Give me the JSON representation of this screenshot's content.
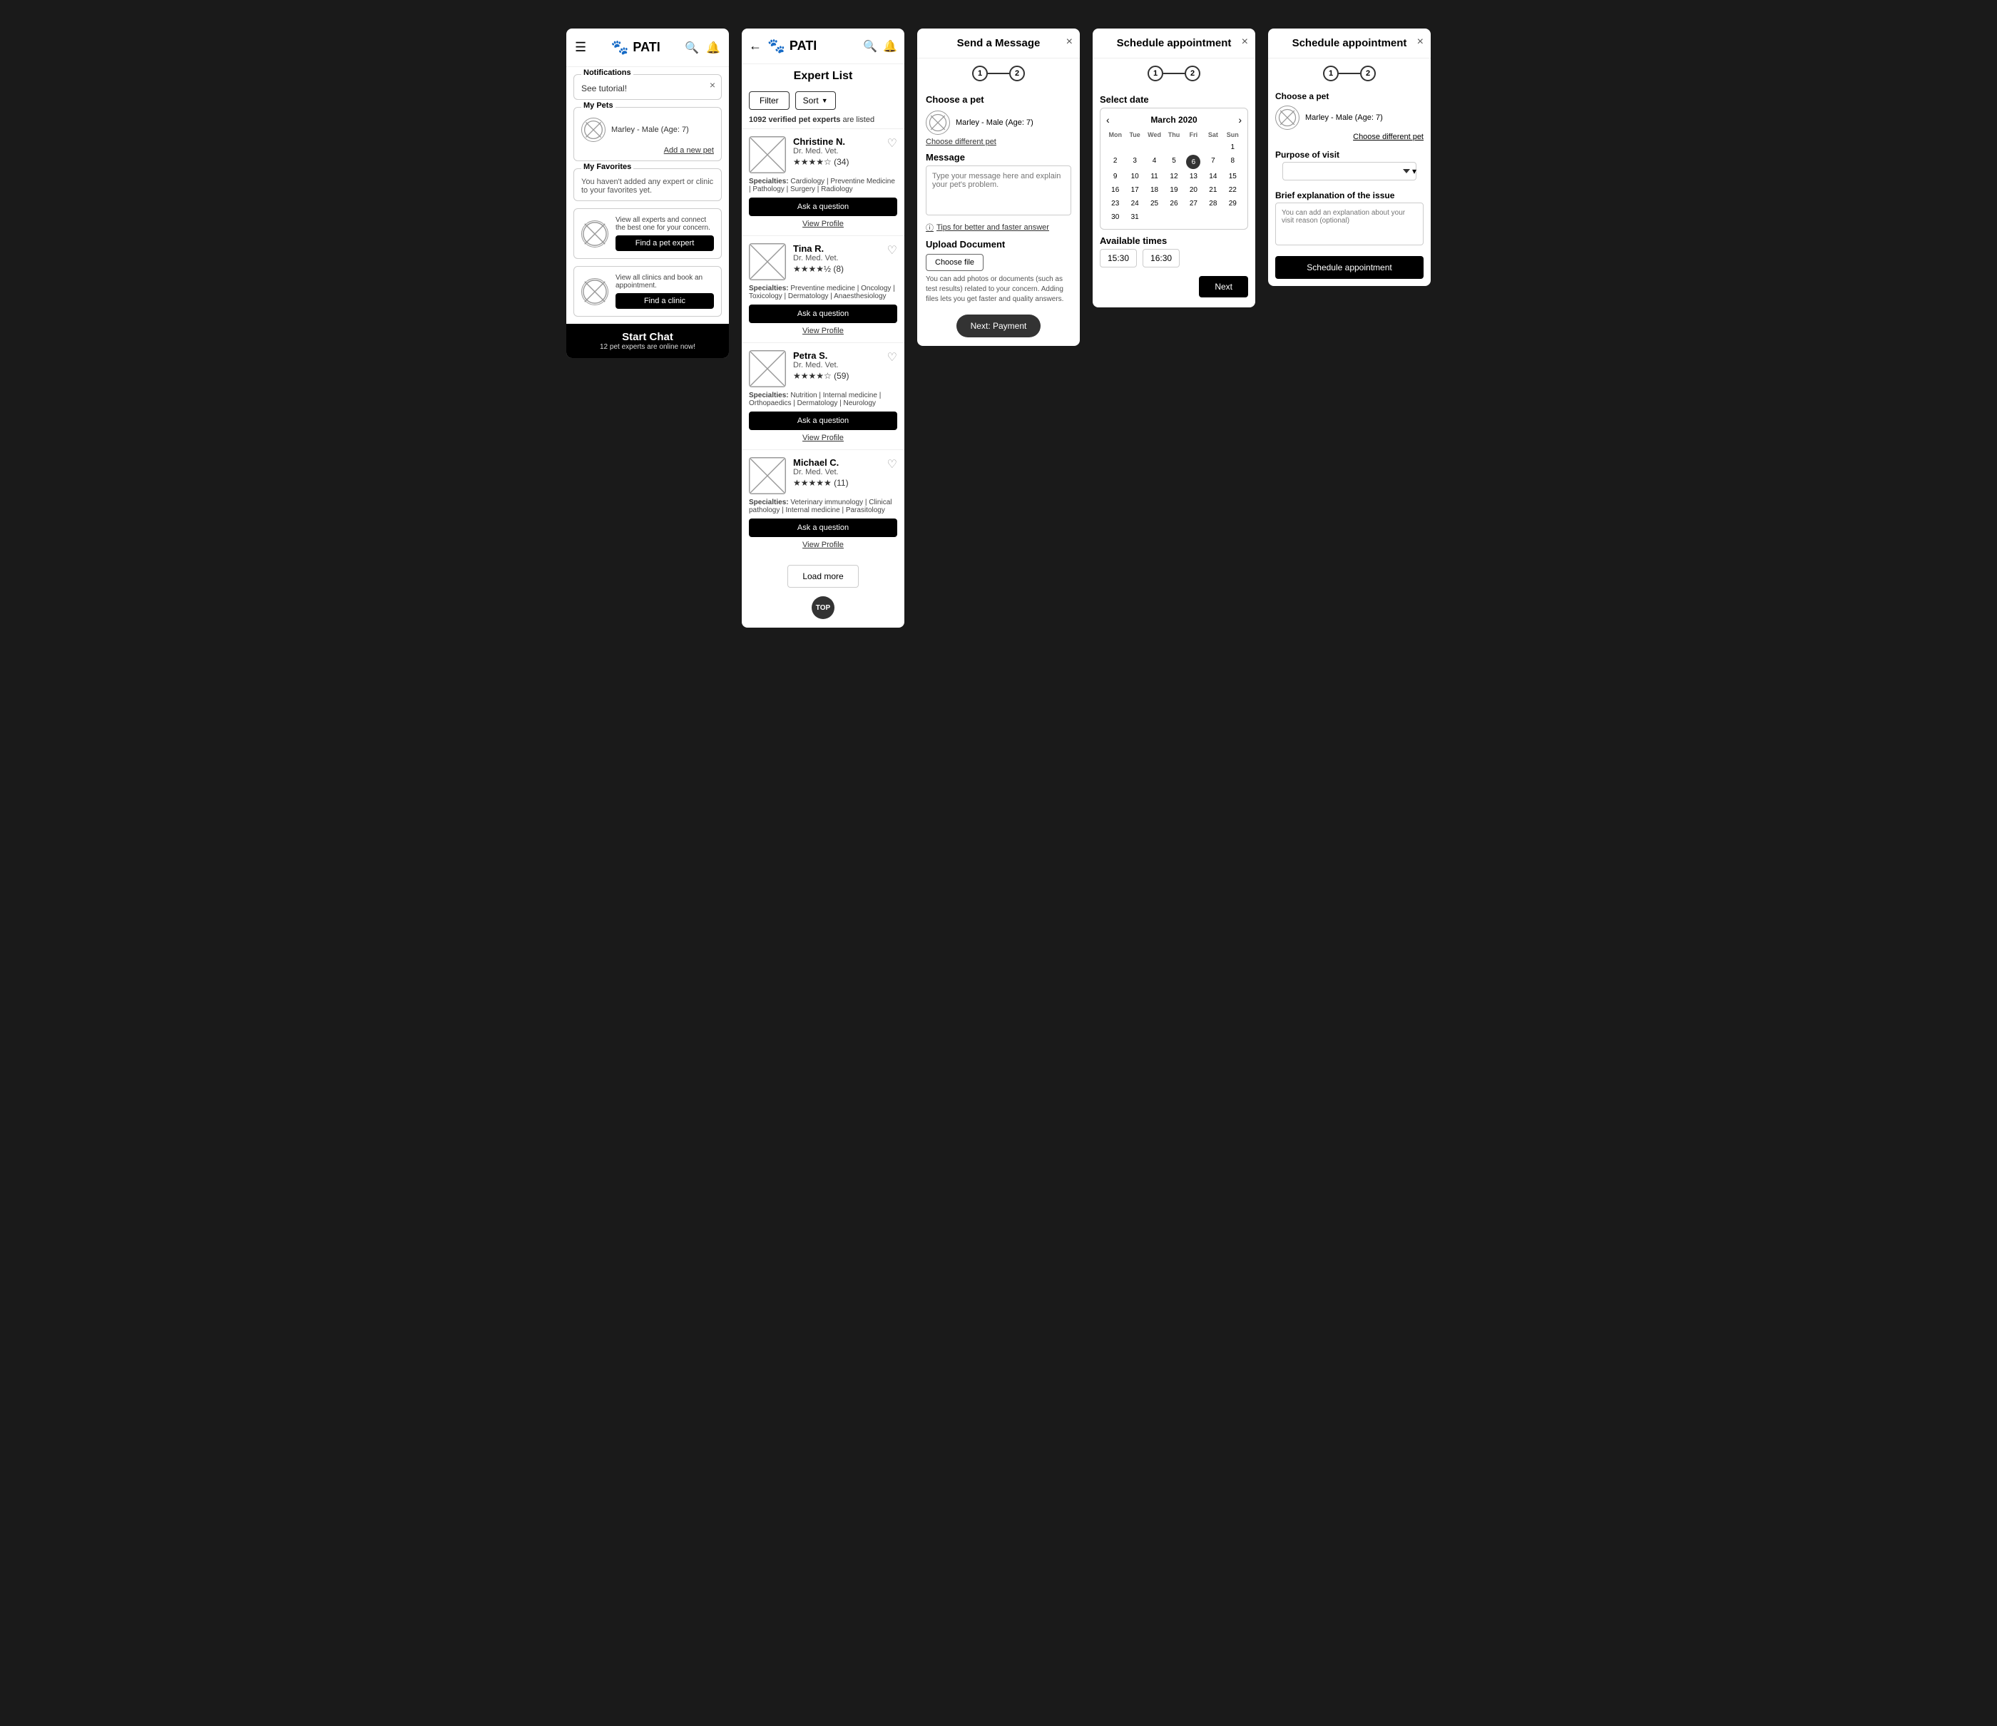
{
  "screen1": {
    "logo": "PATI",
    "notifications": {
      "label": "Notifications",
      "text": "See tutorial!"
    },
    "my_pets": {
      "label": "My Pets",
      "pet": "Marley - Male (Age: 7)",
      "add_pet": "Add a new pet"
    },
    "my_favorites": {
      "label": "My Favorites",
      "text": "You haven't added any expert or clinic to your favorites yet."
    },
    "find_expert": {
      "description": "View all experts and connect the best one for your concern.",
      "button": "Find a pet expert"
    },
    "find_clinic": {
      "description": "View all clinics and  book an appointment.",
      "button": "Find a clinic"
    },
    "start_chat": {
      "title": "Start Chat",
      "subtitle": "12 pet experts are online now!"
    }
  },
  "screen2": {
    "logo": "PATI",
    "title": "Expert List",
    "filter_btn": "Filter",
    "sort_btn": "Sort",
    "expert_count": "1092 verified pet experts are listed",
    "experts": [
      {
        "name": "Christine N.",
        "degree": "Dr. Med. Vet.",
        "rating": "3.5",
        "rating_count": "(34)",
        "specialties": "Cardiology | Preventine Medicine | Pathology | Surgery | Radiology",
        "ask_btn": "Ask a question",
        "view_profile": "View Profile"
      },
      {
        "name": "Tina R.",
        "degree": "Dr. Med. Vet.",
        "rating": "4.5",
        "rating_count": "(8)",
        "specialties": "Preventine medicine | Oncology | Toxicology | Dermatology | Anaesthesiology",
        "ask_btn": "Ask a question",
        "view_profile": "View Profile"
      },
      {
        "name": "Petra S.",
        "degree": "Dr. Med. Vet.",
        "rating": "4.0",
        "rating_count": "(59)",
        "specialties": "Nutrition | Internal medicine | Orthopaedics | Dermatology | Neurology",
        "ask_btn": "Ask a question",
        "view_profile": "View Profile"
      },
      {
        "name": "Michael C.",
        "degree": "Dr. Med. Vet.",
        "rating": "5.0",
        "rating_count": "(11)",
        "specialties": "Veterinary immunology | Clinical pathology | Internal medicine | Parasitology",
        "ask_btn": "Ask a question",
        "view_profile": "View Profile"
      }
    ],
    "load_more": "Load more",
    "top": "TOP"
  },
  "screen3": {
    "title": "Send a Message",
    "close": "×",
    "step1": "1",
    "step2": "2",
    "choose_pet_label": "Choose a pet",
    "pet_name": "Marley - Male (Age: 7)",
    "choose_different": "Choose different pet",
    "message_label": "Message",
    "message_placeholder": "Type your message here and explain your pet's problem.",
    "tips_link": "Tips for better and faster answer",
    "upload_title": "Upload Document",
    "choose_file_btn": "Choose file",
    "upload_desc": "You can add photos or documents (such as test results) related to your concern. Adding files lets you get faster and quality answers.",
    "next_btn": "Next: Payment"
  },
  "screen4": {
    "title": "Schedule appointment",
    "close": "×",
    "step1": "1",
    "step2": "2",
    "select_date_label": "Select date",
    "month": "March 2020",
    "days_header": [
      "Mon",
      "Tue",
      "Wed",
      "Thu",
      "Fri",
      "Sat",
      "Sun"
    ],
    "days": [
      {
        "day": "",
        "empty": true
      },
      {
        "day": "",
        "empty": true
      },
      {
        "day": "",
        "empty": true
      },
      {
        "day": "",
        "empty": true
      },
      {
        "day": "",
        "empty": true
      },
      {
        "day": "",
        "empty": true
      },
      {
        "day": "1",
        "empty": false
      },
      {
        "day": "2",
        "empty": false
      },
      {
        "day": "3",
        "empty": false
      },
      {
        "day": "4",
        "empty": false
      },
      {
        "day": "5",
        "empty": false
      },
      {
        "day": "6",
        "empty": false,
        "today": true
      },
      {
        "day": "7",
        "empty": false
      },
      {
        "day": "8",
        "empty": false
      },
      {
        "day": "9",
        "empty": false
      },
      {
        "day": "10",
        "empty": false
      },
      {
        "day": "11",
        "empty": false
      },
      {
        "day": "12",
        "empty": false
      },
      {
        "day": "13",
        "empty": false
      },
      {
        "day": "14",
        "empty": false
      },
      {
        "day": "15",
        "empty": false
      },
      {
        "day": "16",
        "empty": false
      },
      {
        "day": "17",
        "empty": false
      },
      {
        "day": "18",
        "empty": false
      },
      {
        "day": "19",
        "empty": false
      },
      {
        "day": "20",
        "empty": false
      },
      {
        "day": "21",
        "empty": false
      },
      {
        "day": "22",
        "empty": false
      },
      {
        "day": "23",
        "empty": false
      },
      {
        "day": "24",
        "empty": false
      },
      {
        "day": "25",
        "empty": false
      },
      {
        "day": "26",
        "empty": false
      },
      {
        "day": "27",
        "empty": false
      },
      {
        "day": "28",
        "empty": false
      },
      {
        "day": "29",
        "empty": false
      },
      {
        "day": "30",
        "empty": false
      },
      {
        "day": "31",
        "empty": false
      }
    ],
    "available_times_label": "Available times",
    "time_slots": [
      "15:30",
      "16:30"
    ],
    "next_btn": "Next"
  },
  "screen5": {
    "title": "Schedule appointment",
    "close": "×",
    "step1": "1",
    "step2": "2",
    "pet_name": "Marley - Male (Age: 7)",
    "choose_different": "Choose different pet",
    "purpose_label": "Purpose of visit",
    "purpose_placeholder": "",
    "brief_label": "Brief explanation of the issue",
    "brief_placeholder": "You can add an explanation about your visit reason (optional)",
    "schedule_btn": "Schedule appointment"
  }
}
